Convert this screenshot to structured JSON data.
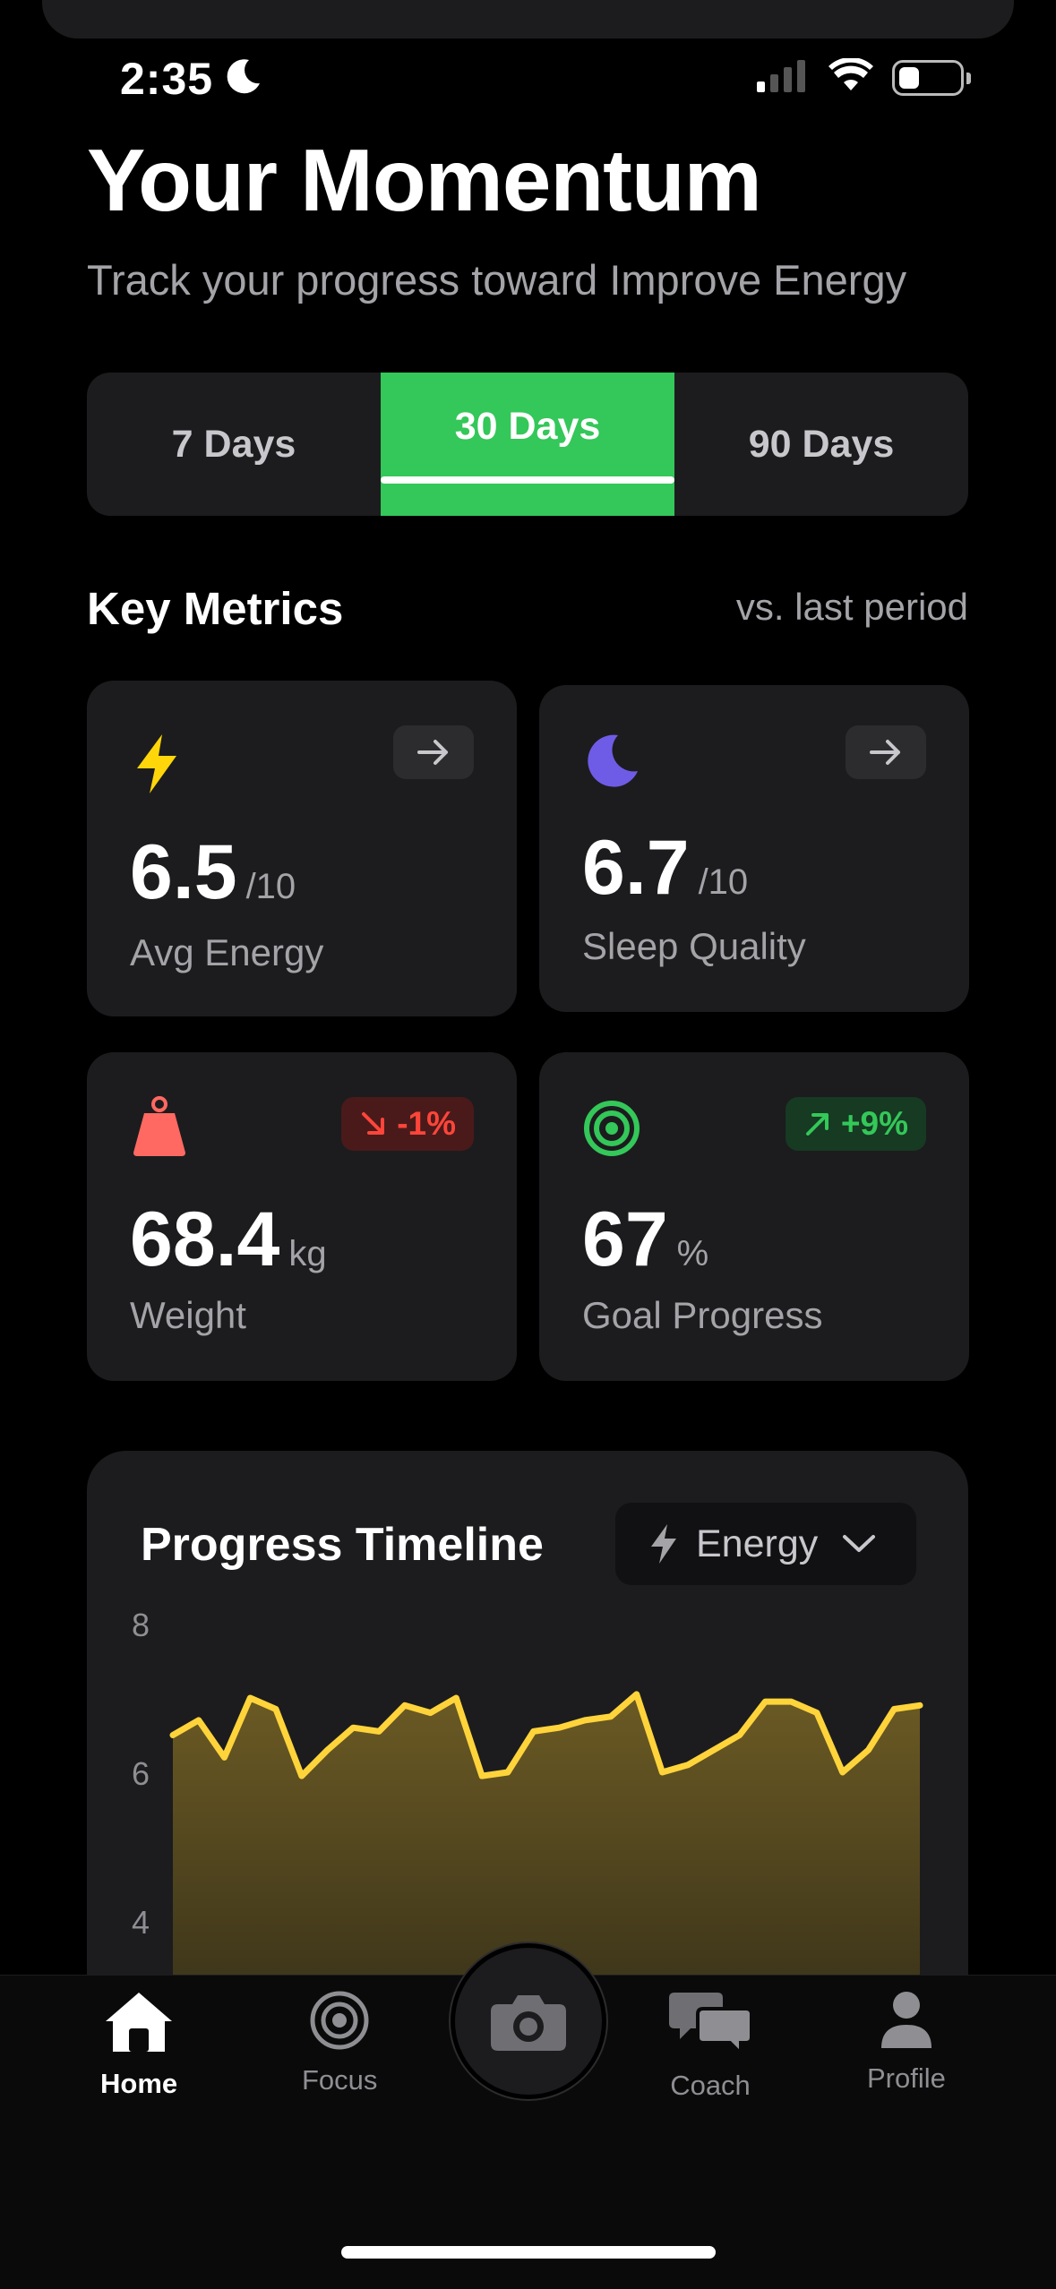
{
  "status_bar": {
    "time": "2:35"
  },
  "header": {
    "title": "Your Momentum",
    "subtitle": "Track your progress toward Improve Energy"
  },
  "range_tabs": [
    {
      "label": "7 Days",
      "active": false
    },
    {
      "label": "30 Days",
      "active": true
    },
    {
      "label": "90 Days",
      "active": false
    }
  ],
  "metrics_section": {
    "title": "Key Metrics",
    "aside": "vs. last period"
  },
  "metrics": [
    {
      "icon": "lightning-icon",
      "value": "6.5",
      "unit": "/10",
      "label": "Avg Energy",
      "change": "",
      "trend": "neutral",
      "color": "#ffd60a"
    },
    {
      "icon": "moon-icon",
      "value": "6.7",
      "unit": "/10",
      "label": "Sleep Quality",
      "change": "",
      "trend": "neutral",
      "color": "#6e5ce6"
    },
    {
      "icon": "weight-icon",
      "value": "68.4",
      "unit": "kg",
      "label": "Weight",
      "change": "-1%",
      "trend": "down",
      "color": "#ff6961"
    },
    {
      "icon": "target-icon",
      "value": "67",
      "unit": "%",
      "label": "Goal Progress",
      "change": "+9%",
      "trend": "up",
      "color": "#34c759"
    }
  ],
  "timeline": {
    "title": "Progress Timeline",
    "selected_metric": "Energy"
  },
  "chart_data": {
    "type": "area",
    "y_ticks": [
      "8",
      "6",
      "4"
    ],
    "ylim": [
      2,
      8
    ],
    "values": [
      6.5,
      6.7,
      6.2,
      7.0,
      6.85,
      5.95,
      6.3,
      6.6,
      6.55,
      6.9,
      6.8,
      7.0,
      5.95,
      6.0,
      6.55,
      6.6,
      6.7,
      6.75,
      7.05,
      6.0,
      6.1,
      6.3,
      6.5,
      6.95,
      6.95,
      6.8,
      6.0,
      6.3,
      6.85,
      6.9
    ],
    "color": "#ffd43b"
  },
  "tab_bar": {
    "items": [
      {
        "label": "Home",
        "icon": "house-icon",
        "active": true
      },
      {
        "label": "Focus",
        "icon": "target-icon",
        "active": false
      },
      {
        "label": "Coach",
        "icon": "chat-bubbles-icon",
        "active": false
      },
      {
        "label": "Profile",
        "icon": "person-icon",
        "active": false
      }
    ],
    "camera_icon": "camera-icon"
  }
}
